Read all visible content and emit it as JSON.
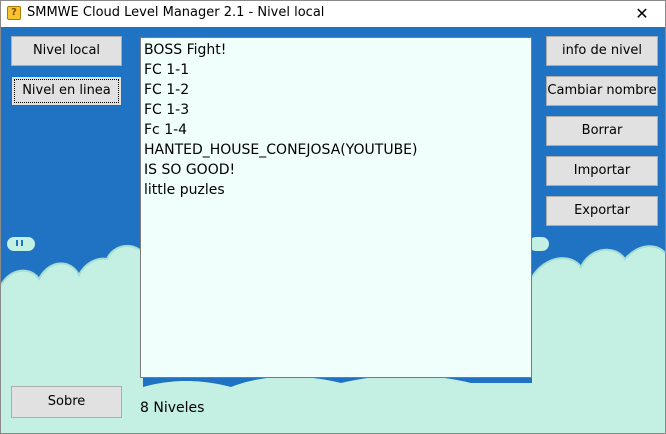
{
  "window": {
    "title": "SMMWE Cloud Level Manager 2.1 - Nivel local",
    "icon": "question-block-icon",
    "close_glyph": "✕"
  },
  "left_buttons": {
    "local": "Nivel local",
    "online": "Nivel en linea",
    "about": "Sobre"
  },
  "right_buttons": {
    "info": "info de nivel",
    "rename": "Cambiar nombre",
    "delete": "Borrar",
    "import": "Importar",
    "export": "Exportar"
  },
  "levels": [
    "BOSS Fight!",
    "FC 1-1",
    "FC 1-2",
    "FC 1-3",
    "Fc 1-4",
    "HANTED_HOUSE_CONEJOSA(YOUTUBE)",
    "IS SO GOOD!",
    "little puzles"
  ],
  "status": {
    "count": "8 Niveles"
  },
  "colors": {
    "sky": "#1f73c2",
    "cloud": "#c4f0e4",
    "list_bg": "#f0fffc"
  }
}
